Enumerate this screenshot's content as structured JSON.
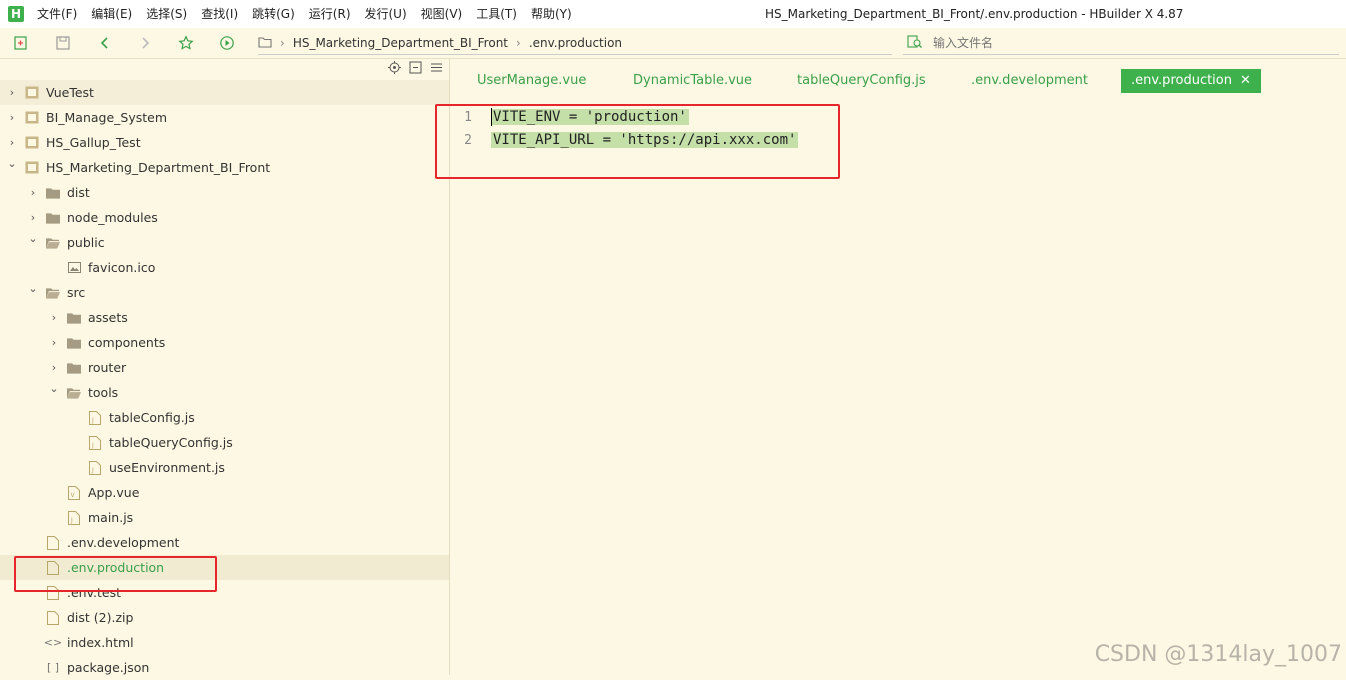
{
  "app": {
    "logo": "H",
    "window_title": "HS_Marketing_Department_BI_Front/.env.production - HBuilder X 4.87"
  },
  "menu": [
    "文件(F)",
    "编辑(E)",
    "选择(S)",
    "查找(I)",
    "跳转(G)",
    "运行(R)",
    "发行(U)",
    "视图(V)",
    "工具(T)",
    "帮助(Y)"
  ],
  "toolbar": {
    "icons": [
      "new-file-icon",
      "save-icon",
      "back-icon",
      "forward-icon",
      "star-icon",
      "run-icon"
    ],
    "path": {
      "project": "HS_Marketing_Department_BI_Front",
      "file": ".env.production"
    },
    "search_placeholder": "输入文件名"
  },
  "sidebar": {
    "tools": [
      "target-icon",
      "collapse-icon",
      "menu-icon"
    ],
    "tree": [
      {
        "label": "VueTest",
        "type": "project",
        "expanded": false
      },
      {
        "label": "BI_Manage_System",
        "type": "project",
        "expanded": false
      },
      {
        "label": "HS_Gallup_Test",
        "type": "project",
        "expanded": false
      },
      {
        "label": "HS_Marketing_Department_BI_Front",
        "type": "project",
        "expanded": true
      },
      {
        "label": "dist",
        "type": "folder",
        "expanded": false
      },
      {
        "label": "node_modules",
        "type": "folder",
        "expanded": false
      },
      {
        "label": "public",
        "type": "folder",
        "expanded": true
      },
      {
        "label": "favicon.ico",
        "type": "image"
      },
      {
        "label": "src",
        "type": "folder",
        "expanded": true
      },
      {
        "label": "assets",
        "type": "folder",
        "expanded": false
      },
      {
        "label": "components",
        "type": "folder",
        "expanded": false
      },
      {
        "label": "router",
        "type": "folder",
        "expanded": false
      },
      {
        "label": "tools",
        "type": "folder",
        "expanded": true
      },
      {
        "label": "tableConfig.js",
        "type": "js"
      },
      {
        "label": "tableQueryConfig.js",
        "type": "js"
      },
      {
        "label": "useEnvironment.js",
        "type": "js"
      },
      {
        "label": "App.vue",
        "type": "vue"
      },
      {
        "label": "main.js",
        "type": "js"
      },
      {
        "label": ".env.development",
        "type": "file"
      },
      {
        "label": ".env.production",
        "type": "file",
        "selected": true
      },
      {
        "label": ".env.test",
        "type": "file"
      },
      {
        "label": "dist (2).zip",
        "type": "file"
      },
      {
        "label": "index.html",
        "type": "html"
      },
      {
        "label": "package.json",
        "type": "json"
      }
    ]
  },
  "editor": {
    "tabs": [
      {
        "label": "UserManage.vue",
        "active": false
      },
      {
        "label": "DynamicTable.vue",
        "active": false
      },
      {
        "label": "tableQueryConfig.js",
        "active": false
      },
      {
        "label": ".env.development",
        "active": false
      },
      {
        "label": ".env.production",
        "active": true,
        "close": "✕"
      }
    ],
    "lines": [
      {
        "no": "1",
        "text": "VITE_ENV = 'production'"
      },
      {
        "no": "2",
        "text": "VITE_API_URL = 'https://api.xxx.com'"
      }
    ]
  },
  "credit": "CSDN @1314lay_1007",
  "colors": {
    "background": "#fdf8e3",
    "accent": "#3fb14c",
    "selection": "#c5dfa9",
    "annotation": "#e6262b"
  }
}
